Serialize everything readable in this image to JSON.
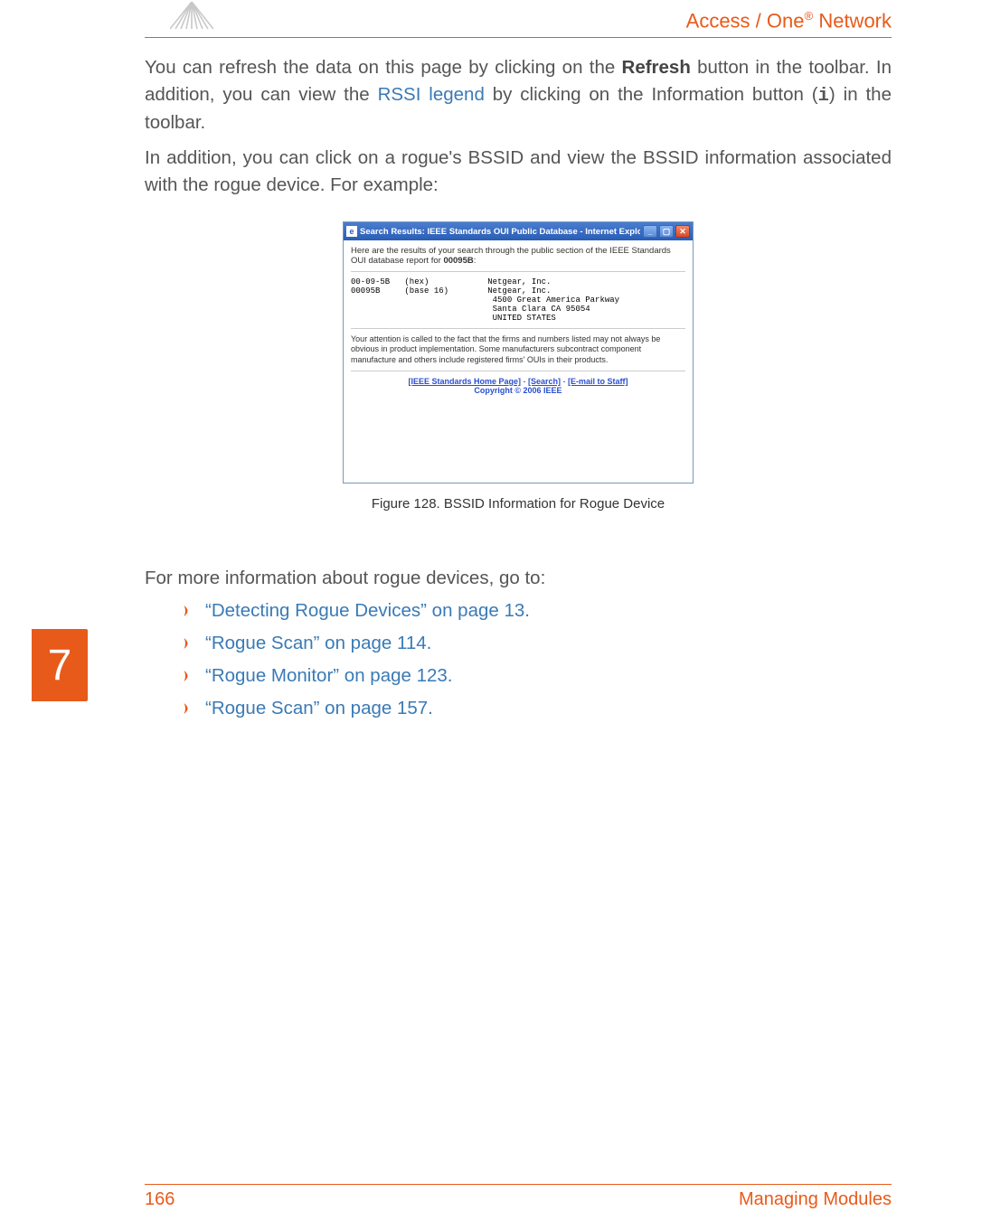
{
  "header": {
    "product": "Access / One",
    "reg": "®",
    "suffix": " Network"
  },
  "paragraphs": {
    "p1_a": "You can refresh the data on this page by clicking on the ",
    "p1_bold": "Refresh",
    "p1_b": " button in the toolbar. In addition, you can view the ",
    "p1_link": "RSSI legend",
    "p1_c": " by clicking on the Information button (",
    "p1_mono": "i",
    "p1_d": ") in the toolbar.",
    "p2": "In addition, you can click on a rogue's BSSID and view the BSSID information associated with the rogue device. For example:",
    "p3": "For more information about rogue devices, go to:"
  },
  "figure": {
    "caption": "Figure 128. BSSID Information for Rogue Device",
    "ie_title": "Search Results: IEEE Standards OUI Public Database - Internet Explorer",
    "intro_a": "Here are the results of your search through the public section of the IEEE Standards OUI database report for ",
    "intro_bold": "00095B",
    "mono_block": "00-09-5B   (hex)            Netgear, Inc.\n00095B     (base 16)        Netgear, Inc.\n                             4500 Great America Parkway\n                             Santa Clara CA 95054\n                             UNITED STATES",
    "note": "Your attention is called to the fact that the firms and numbers listed may not always be obvious in product implementation. Some manufacturers subcontract component manufacture and others include registered firms' OUIs in their products.",
    "footer_links": {
      "home": "[IEEE Standards Home Page]",
      "search": "[Search]",
      "email": "[E-mail to Staff]",
      "copyright": "Copyright © 2006 IEEE"
    }
  },
  "bullets": [
    "“Detecting Rogue Devices” on page 13.",
    "“Rogue Scan” on page 114.",
    "“Rogue Monitor” on page 123.",
    "“Rogue Scan” on page 157."
  ],
  "chapter": "7",
  "footer": {
    "page": "166",
    "section": "Managing Modules"
  }
}
